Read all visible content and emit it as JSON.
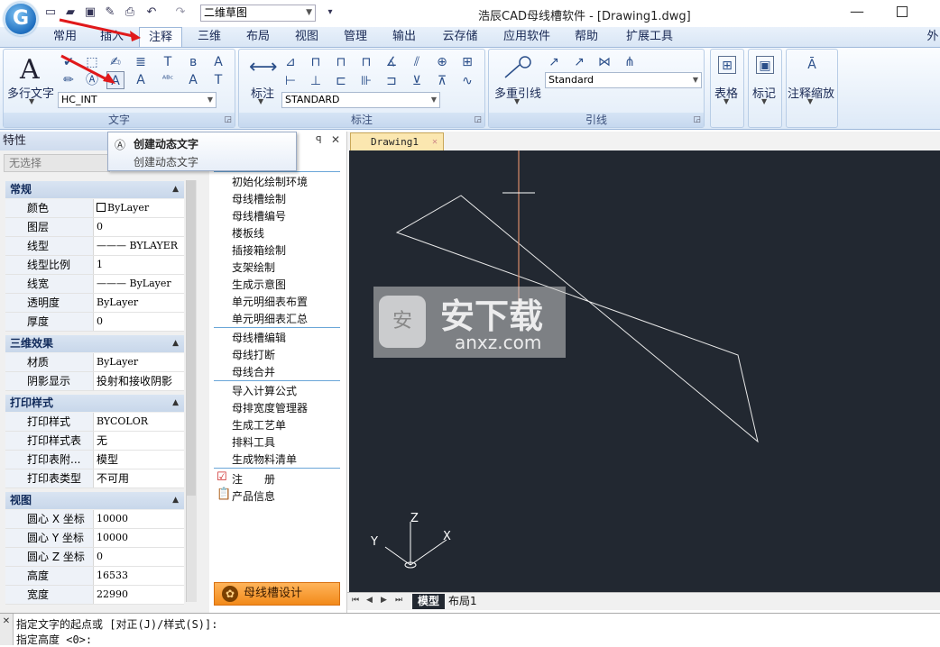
{
  "app": {
    "title": "浩辰CAD母线槽软件 - [Drawing1.dwg]",
    "logo_letter": "G",
    "workspace": "二维草图",
    "window_extra": "外"
  },
  "qat_icons": [
    "new-file-icon",
    "open-folder-icon",
    "save-icon",
    "save-as-icon",
    "print-icon",
    "undo-icon",
    "redo-icon"
  ],
  "tabs": [
    "常用",
    "插入",
    "注释",
    "三维",
    "布局",
    "视图",
    "管理",
    "输出",
    "云存储",
    "应用软件",
    "帮助",
    "扩展工具"
  ],
  "active_tab": "注释",
  "ribbon": {
    "text_group": {
      "label": "文字",
      "big_button": "多行文字",
      "style_combo": "HC_INT"
    },
    "dim_group": {
      "label": "标注",
      "big_button": "标注",
      "style_combo": "STANDARD"
    },
    "leader_group": {
      "label": "引线",
      "big_button": "多重引线",
      "style_combo": "Standard"
    },
    "table_button": "表格",
    "mark_button": "标记",
    "scale_button": "注释缩放"
  },
  "tooltip": {
    "title": "创建动态文字",
    "desc": "创建动态文字"
  },
  "properties": {
    "header": "特性",
    "selection": "无选择",
    "sections": [
      {
        "title": "常规",
        "rows": [
          {
            "name": "颜色",
            "value": "ByLayer"
          },
          {
            "name": "图层",
            "value": "0"
          },
          {
            "name": "线型",
            "value": "——— BYLAYER"
          },
          {
            "name": "线型比例",
            "value": "1"
          },
          {
            "name": "线宽",
            "value": "——— ByLayer"
          },
          {
            "name": "透明度",
            "value": "ByLayer"
          },
          {
            "name": "厚度",
            "value": "0"
          }
        ]
      },
      {
        "title": "三维效果",
        "rows": [
          {
            "name": "材质",
            "value": "ByLayer"
          },
          {
            "name": "阴影显示",
            "value": "投射和接收阴影"
          }
        ]
      },
      {
        "title": "打印样式",
        "rows": [
          {
            "name": "打印样式",
            "value": "BYCOLOR"
          },
          {
            "name": "打印样式表",
            "value": "无"
          },
          {
            "name": "打印表附...",
            "value": "模型"
          },
          {
            "name": "打印表类型",
            "value": "不可用"
          }
        ]
      },
      {
        "title": "视图",
        "rows": [
          {
            "name": "圆心 X 坐标",
            "value": "10000"
          },
          {
            "name": "圆心 Y 坐标",
            "value": "10000"
          },
          {
            "name": "圆心 Z 坐标",
            "value": "0"
          },
          {
            "name": "高度",
            "value": "16533"
          },
          {
            "name": "宽度",
            "value": "22990"
          }
        ]
      }
    ]
  },
  "bus_menu": {
    "group1": [
      "初始化绘制环境",
      "母线槽绘制",
      "母线槽编号",
      "楼板线",
      "插接箱绘制",
      "支架绘制",
      "生成示意图",
      "单元明细表布置",
      "单元明细表汇总"
    ],
    "group2": [
      "母线槽编辑",
      "母线打断",
      "母线合并"
    ],
    "group3": [
      "导入计算公式",
      "母排宽度管理器",
      "生成工艺单",
      "排料工具",
      "生成物料清单"
    ],
    "register": "注　　册",
    "product_info": "产品信息",
    "footer_button": "母线槽设计"
  },
  "document": {
    "tab": "Drawing1",
    "layout_tabs": [
      "模型",
      "布局1"
    ],
    "ucs_labels": {
      "x": "X",
      "y": "Y",
      "z": "Z"
    }
  },
  "watermark": {
    "text": "安下载",
    "sub": "anxz.com"
  },
  "command_lines": [
    "指定文字的起点或 [对正(J)/样式(S)]:",
    "指定高度 <0>:"
  ]
}
